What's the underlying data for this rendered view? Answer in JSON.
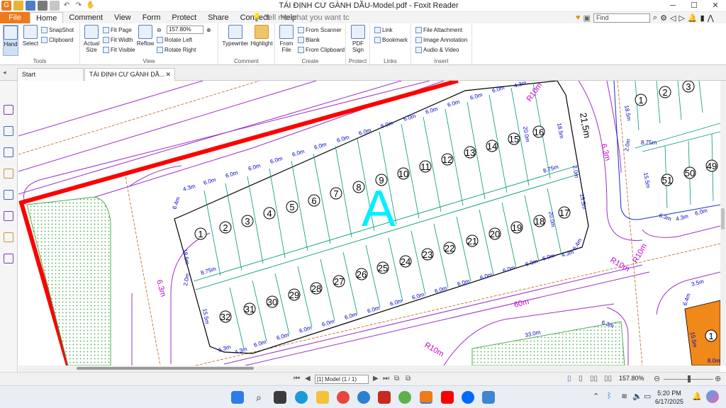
{
  "window": {
    "title": "TÁI ĐỊNH CƯ GÀNH DẦU-Model.pdf - Foxit Reader"
  },
  "menu": {
    "file": "File",
    "tabs": [
      "Home",
      "Comment",
      "View",
      "Form",
      "Protect",
      "Share",
      "Connect",
      "Help"
    ],
    "tell_me": "Tell me what you want tc",
    "find_placeholder": "Find"
  },
  "ribbon": {
    "tools": {
      "label": "Tools",
      "hand": "Hand",
      "select": "Select",
      "snapshot": "SnapShot",
      "clipboard": "Clipboard"
    },
    "view": {
      "label": "View",
      "actual_size": "Actual Size",
      "fit_page": "Fit Page",
      "fit_width": "Fit Width",
      "fit_visible": "Fit Visible",
      "reflow": "Reflow",
      "zoom": "157.80%",
      "rotate_left": "Rotate Left",
      "rotate_right": "Rotate Right"
    },
    "comment": {
      "label": "Comment",
      "typewriter": "Typewriter",
      "highlight": "Highlight"
    },
    "create": {
      "label": "Create",
      "from_file": "From File",
      "from_scanner": "From Scanner",
      "blank": "Blank",
      "from_clipboard": "From Clipboard"
    },
    "protect": {
      "label": "Protect",
      "pdf_sign": "PDF Sign"
    },
    "links": {
      "label": "Links",
      "link": "Link",
      "bookmark": "Bookmark"
    },
    "insert": {
      "label": "Insert",
      "file_attachment": "File Attachment",
      "image_annotation": "Image Annotation",
      "audio_video": "Audio & Video"
    }
  },
  "doc_tabs": {
    "start": "Start",
    "current": "TÁI ĐỊNH CƯ GÀNH DẦ..."
  },
  "drawing": {
    "block_label": "A",
    "top_lots": [
      "1",
      "2",
      "3",
      "4",
      "5",
      "6",
      "7",
      "8",
      "9",
      "10",
      "11",
      "12",
      "13",
      "14",
      "15",
      "16",
      "17"
    ],
    "bottom_lots": [
      "32",
      "31",
      "30",
      "29",
      "28",
      "27",
      "26",
      "25",
      "24",
      "23",
      "22",
      "21",
      "20",
      "19",
      "18"
    ],
    "right_top_lots": [
      "1",
      "2",
      "3"
    ],
    "right_lots": [
      "51",
      "50",
      "49"
    ],
    "right_edge_lot": "1",
    "dim_6m": "6.0m",
    "dim_4_3": "4.3m",
    "dim_6_4": "6.4m",
    "dim_18_5": "18.5m",
    "dim_2_0": "2.0m",
    "dim_8_75": "8.75m",
    "dim_15_5": "15.5m",
    "dim_6_3": "6.3m",
    "dim_20": "20.0m",
    "dim_20_0m": "20.0m",
    "dim_21_5": "21,5m",
    "dim_60": "60m",
    "dim_33": "33.0m",
    "dim_3_5": "3.5m",
    "dim_8_0": "8.0m",
    "dim_r10": "R10m",
    "dim_63": "6.3m"
  },
  "status": {
    "page": "[1] Model (1 / 1)",
    "zoom": "157.80%"
  },
  "taskbar": {
    "time": "5:20 PM",
    "date": "6/17/2025"
  },
  "colors": {
    "accent": "#ef7a1a",
    "red_boundary": "#ff0000",
    "lot_lines": "#009977",
    "dim_text": "#0000c8",
    "magenta_text": "#cc00cc",
    "block_letter": "#00f0ff"
  }
}
